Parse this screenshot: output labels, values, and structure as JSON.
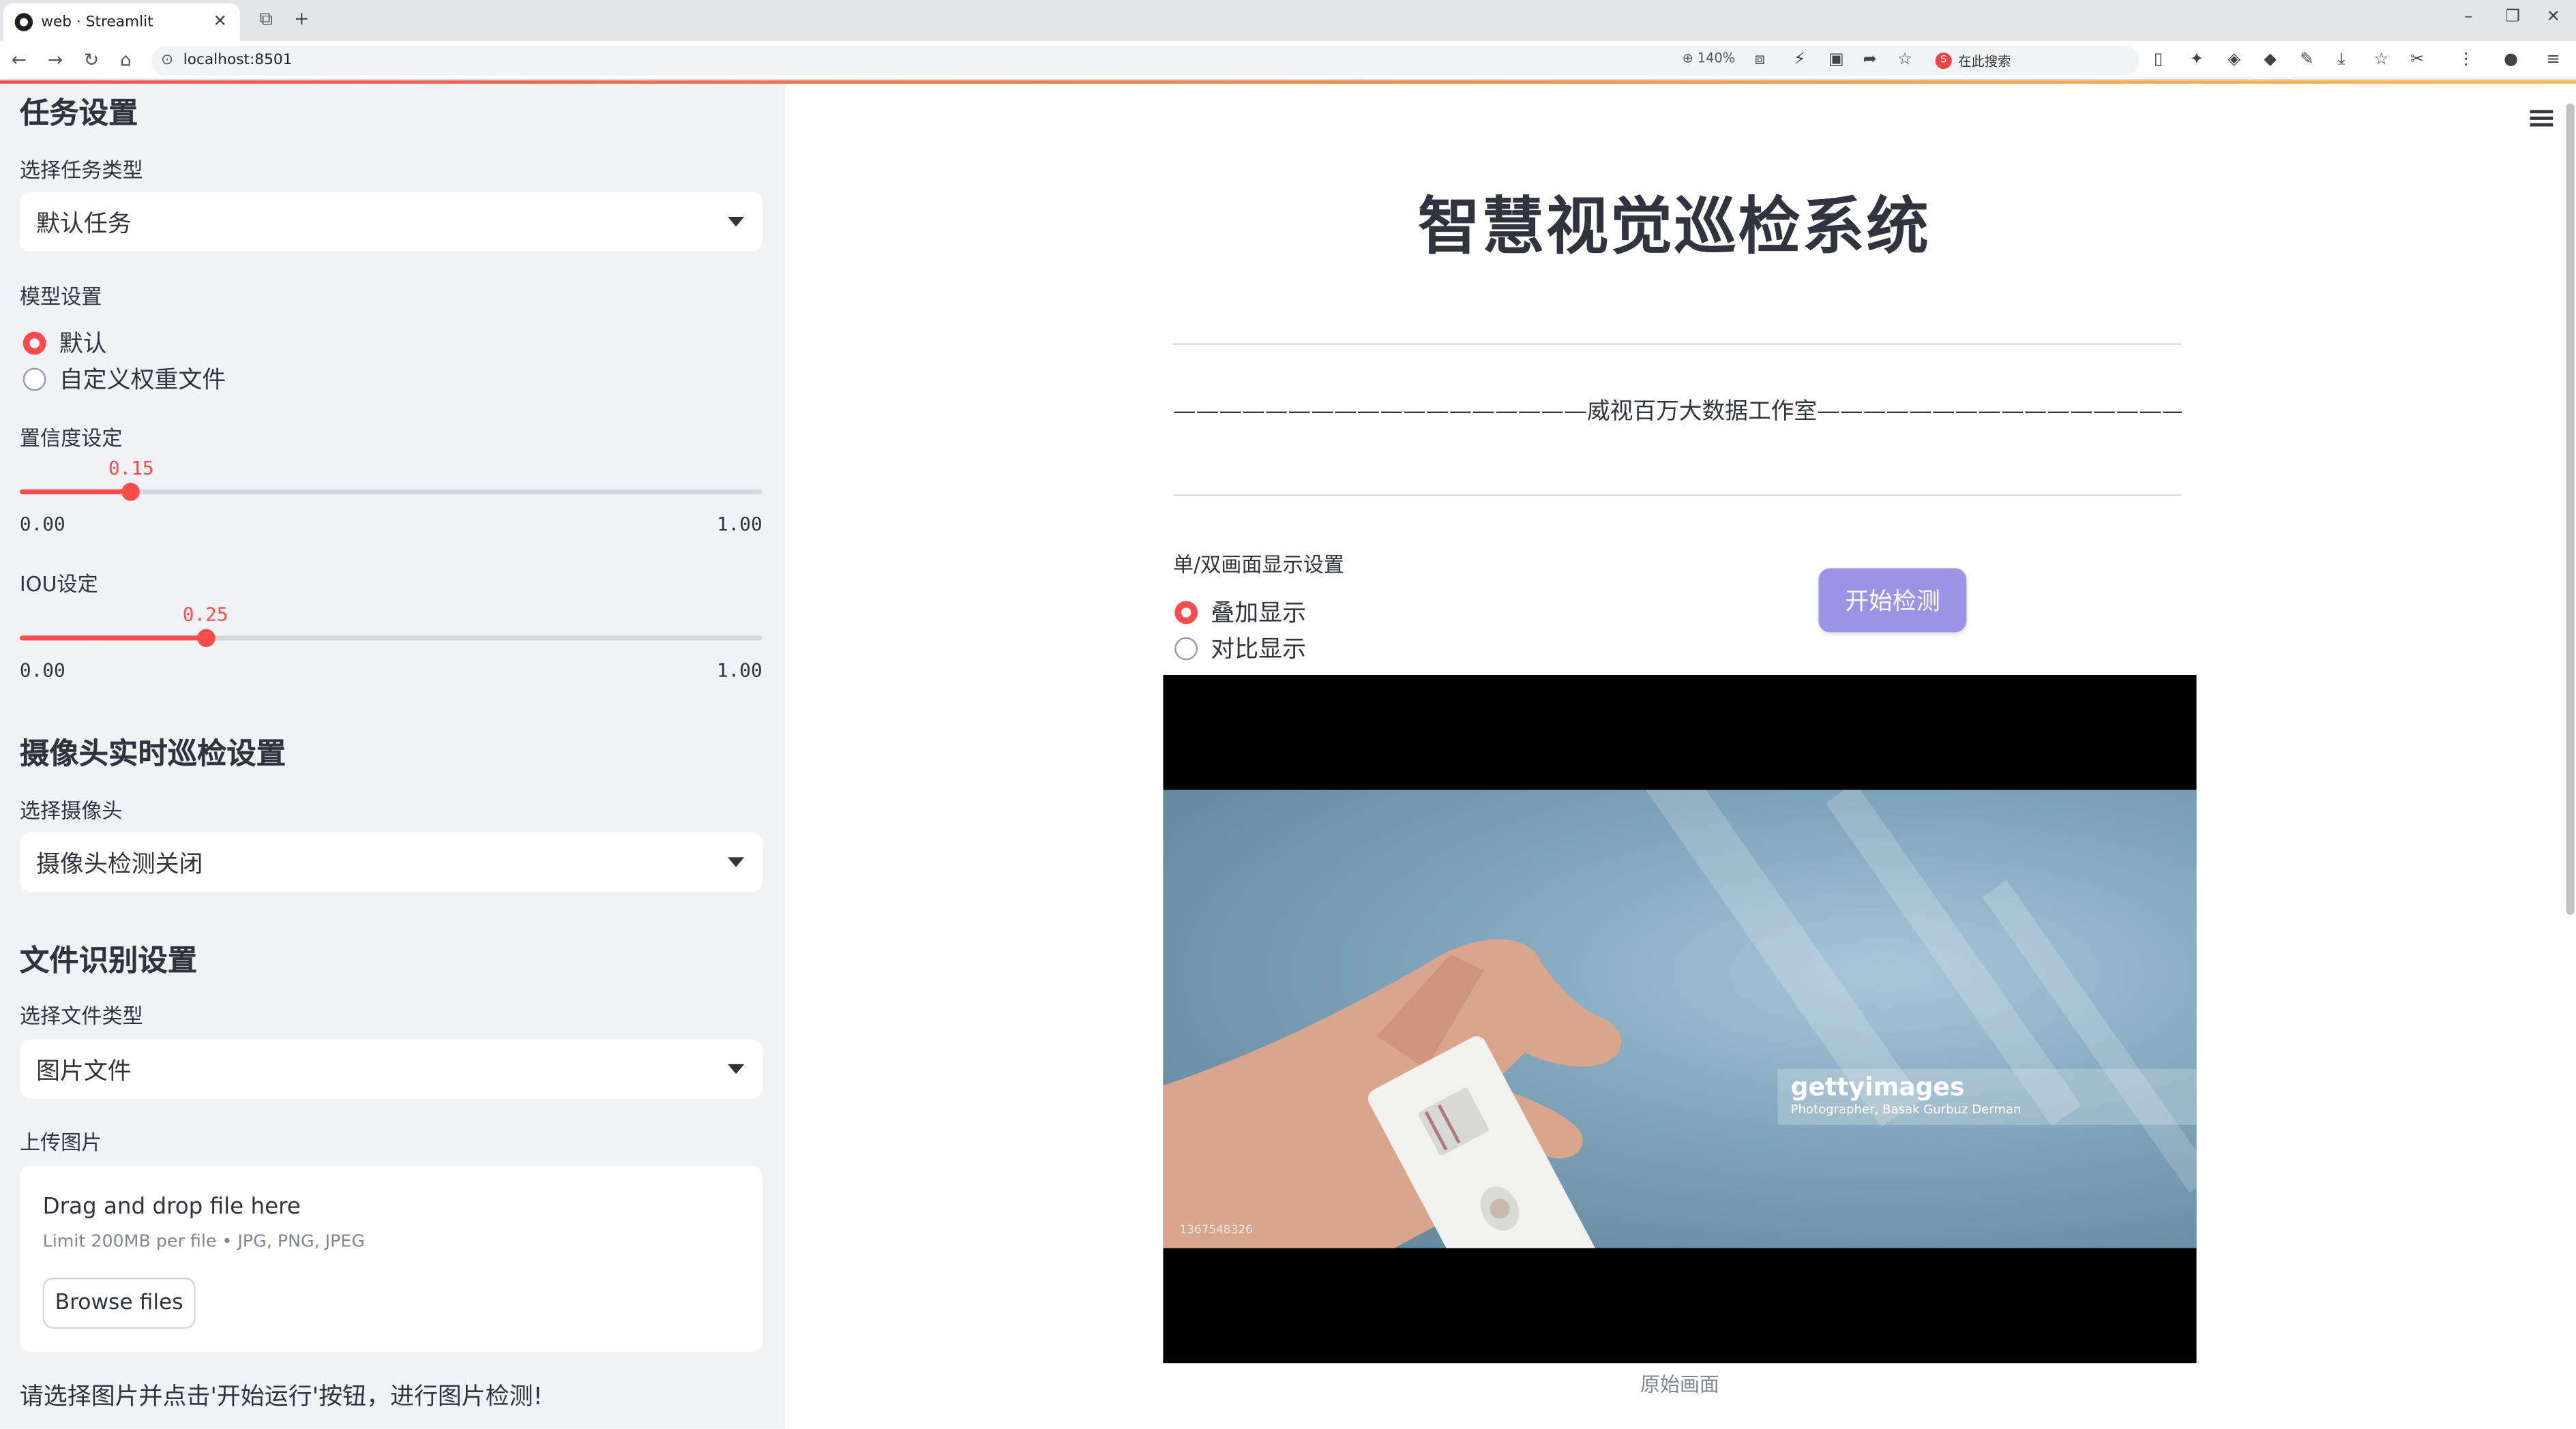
{
  "browser": {
    "tab_title": "web · Streamlit",
    "tab_close": "✕",
    "url": "localhost:8501",
    "zoom": "140%",
    "search_placeholder": "在此搜索"
  },
  "sidebar": {
    "task_section_title": "任务设置",
    "task_type_label": "选择任务类型",
    "task_type_value": "默认任务",
    "model_label": "模型设置",
    "model_options": [
      "默认",
      "自定义权重文件"
    ],
    "model_selected": 0,
    "confidence_label": "置信度设定",
    "confidence": {
      "value": "0.15",
      "min": "0.00",
      "max": "1.00",
      "fraction": 0.15
    },
    "iou_label": "IOU设定",
    "iou": {
      "value": "0.25",
      "min": "0.00",
      "max": "1.00",
      "fraction": 0.25
    },
    "camera_section_title": "摄像头实时巡检设置",
    "camera_label": "选择摄像头",
    "camera_value": "摄像头检测关闭",
    "file_section_title": "文件识别设置",
    "file_type_label": "选择文件类型",
    "file_type_value": "图片文件",
    "upload_label": "上传图片",
    "dropzone_title": "Drag and drop file here",
    "dropzone_limit": "Limit 200MB per file • JPG, PNG, JPEG",
    "browse_label": "Browse files",
    "hint": "请选择图片并点击'开始运行'按钮，进行图片检测!"
  },
  "main": {
    "title": "智慧视觉巡检系统",
    "subtitle": "——————————————————威视百万大数据工作室——————————————————",
    "display_mode_label": "单/双画面显示设置",
    "display_options": [
      "叠加显示",
      "对比显示"
    ],
    "display_selected": 0,
    "start_button": "开始检测",
    "image_watermark_brand": "gettyimages",
    "image_watermark_credit": "Photographer, Basak Gurbuz Derman",
    "image_id": "1367548326",
    "caption": "原始画面"
  },
  "colors": {
    "accent": "#ff4b4b",
    "sidebar_bg": "#f0f2f6",
    "start_button": "#9b94e6"
  }
}
